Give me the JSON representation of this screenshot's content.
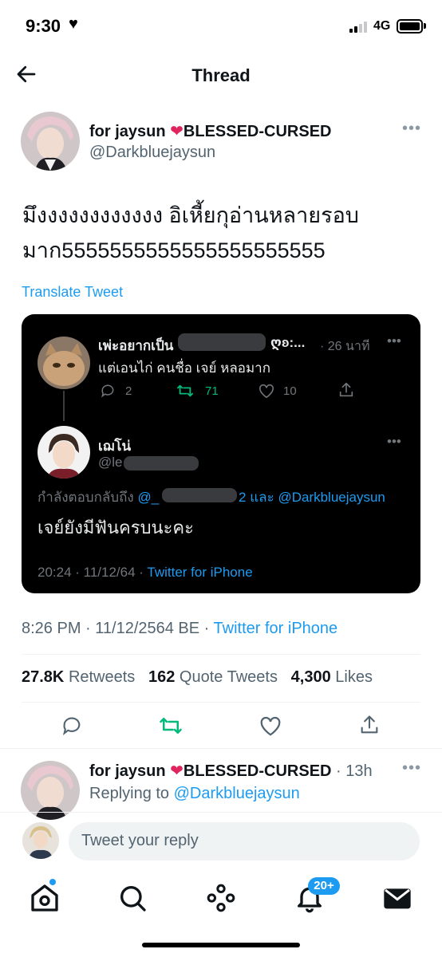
{
  "status_bar": {
    "time": "9:30",
    "heart": "♥",
    "network": "4G"
  },
  "nav": {
    "title": "Thread",
    "back_icon": "back-arrow-icon"
  },
  "main_tweet": {
    "display_name": "for jaysun",
    "name_suffix": "BLESSED-CURSED",
    "handle": "@Darkbluejaysun",
    "text_line1": "มึงงงงงงงงงงงง อิเหี้ยกุอ่านหลายรอบ",
    "text_line2": "มาก5555555555555555555555",
    "translate_label": "Translate Tweet",
    "timestamp": "8:26 PM · 11/12/2564 BE · ",
    "source": "Twitter for iPhone",
    "retweets_count": "27.8K",
    "retweets_label": "Retweets",
    "quotes_count": "162",
    "quotes_label": "Quote Tweets",
    "likes_count": "4,300",
    "likes_label": "Likes"
  },
  "quoted": {
    "parent": {
      "display_name": "เพ่ะอยากเป็น",
      "name_tail": "ღʚ:...",
      "time": "· 26 นาที",
      "text": "แต่เอนไก่ คนชื่อ เจย์ หลอมาก",
      "replies": "2",
      "retweets": "71",
      "likes": "10"
    },
    "reply": {
      "display_name": "เฌโน่",
      "handle_prefix": "@le",
      "replying_prefix": "กำลังตอบกลับถึง",
      "replying_user1_prefix": "@_",
      "replying_user1_suffix": "2",
      "replying_and": "และ",
      "replying_user2": "@Darkbluejaysun",
      "text": "เจย์ยังมีฟันครบนะคะ",
      "timestamp": "20:24 · 11/12/64 · ",
      "source": "Twitter for iPhone"
    }
  },
  "reply_preview": {
    "display_name": "for jaysun",
    "name_suffix": "BLESSED-CURSED",
    "time": "· 13h",
    "replying_label": "Replying to",
    "replying_to": "@Darkbluejaysun"
  },
  "composer": {
    "placeholder": "Tweet your reply"
  },
  "tabbar": {
    "notification_badge": "20+"
  },
  "colors": {
    "accent": "#1d9bf0",
    "retweet_green": "#00ba7c",
    "heart_red": "#f4212e"
  }
}
